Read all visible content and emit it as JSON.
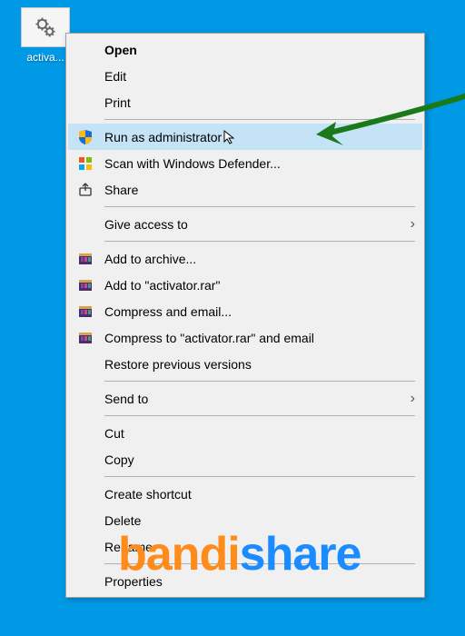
{
  "desktop": {
    "icon_label": "activa..."
  },
  "context_menu": {
    "open": "Open",
    "edit": "Edit",
    "print": "Print",
    "run_as_admin": "Run as administrator",
    "scan_defender": "Scan with Windows Defender...",
    "share": "Share",
    "give_access": "Give access to",
    "add_archive": "Add to archive...",
    "add_to_rar": "Add to \"activator.rar\"",
    "compress_email": "Compress and email...",
    "compress_rar_email": "Compress to \"activator.rar\" and email",
    "restore_versions": "Restore previous versions",
    "send_to": "Send to",
    "cut": "Cut",
    "copy": "Copy",
    "create_shortcut": "Create shortcut",
    "delete": "Delete",
    "rename": "Rename",
    "properties": "Properties"
  },
  "watermark": {
    "part1": "bandi",
    "part2": "share"
  }
}
